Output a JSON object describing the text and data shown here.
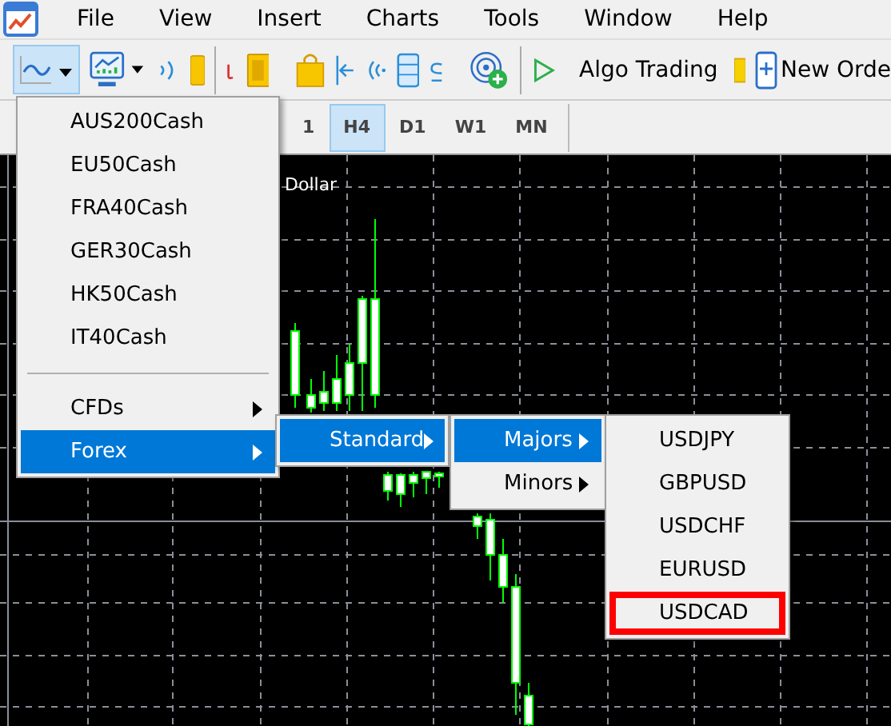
{
  "menu_bar": {
    "items": [
      "File",
      "View",
      "Insert",
      "Charts",
      "Tools",
      "Window",
      "Help"
    ]
  },
  "toolbar": {
    "algo_trading": "Algo Trading",
    "new_order": "New Orde"
  },
  "timeframes": [
    {
      "label": "1",
      "selected": false
    },
    {
      "label": "H4",
      "selected": true
    },
    {
      "label": "D1",
      "selected": false
    },
    {
      "label": "W1",
      "selected": false
    },
    {
      "label": "MN",
      "selected": false
    }
  ],
  "chart": {
    "title": "Dollar"
  },
  "menus": [
    {
      "items": [
        {
          "kind": "item",
          "label": "AUS200Cash",
          "submenu": false,
          "selected": false
        },
        {
          "kind": "item",
          "label": "EU50Cash",
          "submenu": false,
          "selected": false
        },
        {
          "kind": "item",
          "label": "FRA40Cash",
          "submenu": false,
          "selected": false
        },
        {
          "kind": "item",
          "label": "GER30Cash",
          "submenu": false,
          "selected": false
        },
        {
          "kind": "item",
          "label": "HK50Cash",
          "submenu": false,
          "selected": false
        },
        {
          "kind": "item",
          "label": "IT40Cash",
          "submenu": false,
          "selected": false
        },
        {
          "kind": "separator"
        },
        {
          "kind": "item",
          "label": "CFDs",
          "submenu": true,
          "selected": false
        },
        {
          "kind": "item",
          "label": "Forex",
          "submenu": true,
          "selected": true
        }
      ]
    },
    {
      "items": [
        {
          "kind": "item",
          "label": "Standard",
          "submenu": true,
          "selected": true
        }
      ]
    },
    {
      "items": [
        {
          "kind": "item",
          "label": "Majors",
          "submenu": true,
          "selected": true
        },
        {
          "kind": "item",
          "label": "Minors",
          "submenu": true,
          "selected": false
        }
      ]
    },
    {
      "items": [
        {
          "kind": "item",
          "label": "USDJPY",
          "submenu": false,
          "selected": false,
          "highlighted": false
        },
        {
          "kind": "item",
          "label": "GBPUSD",
          "submenu": false,
          "selected": false,
          "highlighted": false
        },
        {
          "kind": "item",
          "label": "USDCHF",
          "submenu": false,
          "selected": false,
          "highlighted": false
        },
        {
          "kind": "item",
          "label": "EURUSD",
          "submenu": false,
          "selected": false,
          "highlighted": false
        },
        {
          "kind": "item",
          "label": "USDCAD",
          "submenu": false,
          "selected": false,
          "highlighted": true
        }
      ]
    }
  ]
}
